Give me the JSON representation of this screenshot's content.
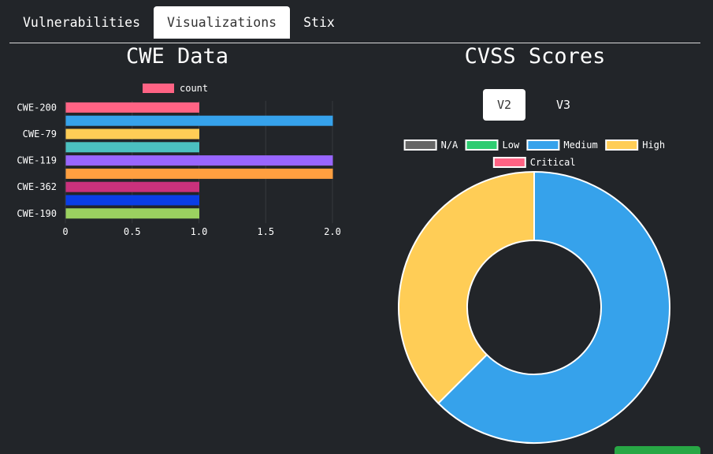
{
  "tabs": [
    {
      "label": "Vulnerabilities",
      "active": false
    },
    {
      "label": "Visualizations",
      "active": true
    },
    {
      "label": "Stix",
      "active": false
    }
  ],
  "cwe_title": "CWE Data",
  "cvss_title": "CVSS Scores",
  "cvss_version_buttons": [
    {
      "label": "V2",
      "active": true
    },
    {
      "label": "V3",
      "active": false
    }
  ],
  "chart_data": [
    {
      "type": "bar",
      "orientation": "horizontal",
      "title": "CWE Data",
      "legend": {
        "position": "top",
        "entries": [
          {
            "label": "count",
            "color": "#ff6384"
          }
        ]
      },
      "categories": [
        "CWE-200",
        "",
        "CWE-79",
        "",
        "CWE-119",
        "",
        "CWE-362",
        "",
        "CWE-190"
      ],
      "series": [
        {
          "name": "count",
          "values": [
            1,
            2,
            1,
            1,
            2,
            2,
            1,
            1,
            1
          ],
          "colors": [
            "#ff6384",
            "#36a2eb",
            "#ffcd56",
            "#4bc0c0",
            "#9966ff",
            "#ff9f40",
            "#c9317c",
            "#0a3ee6",
            "#9bd160"
          ]
        }
      ],
      "xlim": [
        0,
        2
      ],
      "x_ticks": [
        "0",
        "0.5",
        "1.0",
        "1.5",
        "2.0"
      ],
      "grid": true
    },
    {
      "type": "pie",
      "variant": "doughnut",
      "title": "CVSS Scores",
      "legend": {
        "position": "top",
        "entries": [
          {
            "label": "N/A",
            "color": "#666666"
          },
          {
            "label": "Low",
            "color": "#2ecc71"
          },
          {
            "label": "Medium",
            "color": "#36a2eb"
          },
          {
            "label": "High",
            "color": "#ffcd56"
          },
          {
            "label": "Critical",
            "color": "#ff6384"
          }
        ]
      },
      "labels": [
        "N/A",
        "Low",
        "Medium",
        "High",
        "Critical"
      ],
      "values": [
        0,
        0,
        5,
        3,
        0
      ]
    }
  ]
}
